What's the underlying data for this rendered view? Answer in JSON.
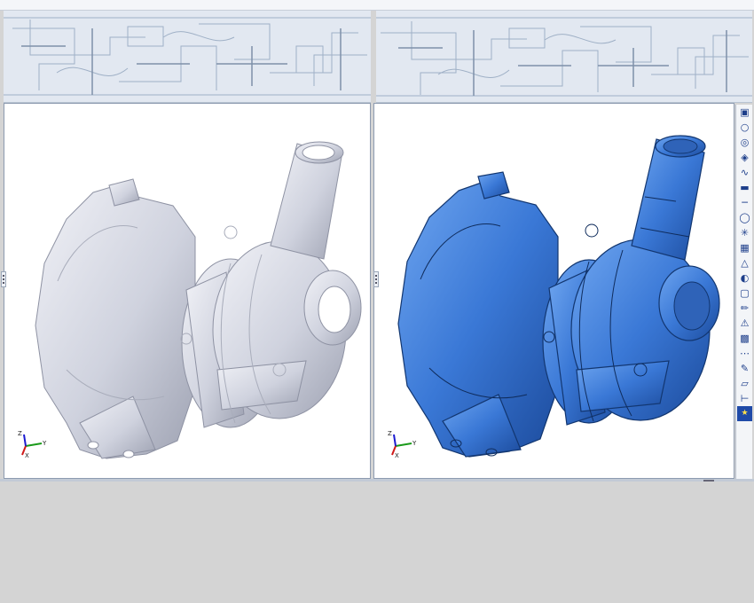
{
  "window": {
    "layout": "split-view",
    "background_color": "#d4d4d4"
  },
  "left_view": {
    "model": "turbocharger",
    "display_mode": "scanned mesh",
    "color": "#d6d9e4",
    "triad": {
      "x_label": "X",
      "y_label": "Y",
      "z_label": "Z"
    }
  },
  "right_view": {
    "model": "turbocharger",
    "display_mode": "surface model",
    "color": "#3a78d6",
    "triad": {
      "x_label": "X",
      "y_label": "Y",
      "z_label": "Z"
    }
  },
  "toolbar": {
    "icons": [
      "view-select-icon",
      "view-rotate-icon",
      "view-pan-icon",
      "view-zoom-icon",
      "curve-icon",
      "surface-icon",
      "line-icon",
      "circle-icon",
      "point-icon",
      "mesh-icon",
      "triangle-icon",
      "circle-tool-icon",
      "box-icon",
      "sketch-icon",
      "warning-triangle-icon",
      "grid-icon",
      "dots-icon",
      "edit-icon",
      "plane-icon",
      "axis-icon",
      "highlight-icon"
    ],
    "highlight_color": "#1f4aa8"
  }
}
